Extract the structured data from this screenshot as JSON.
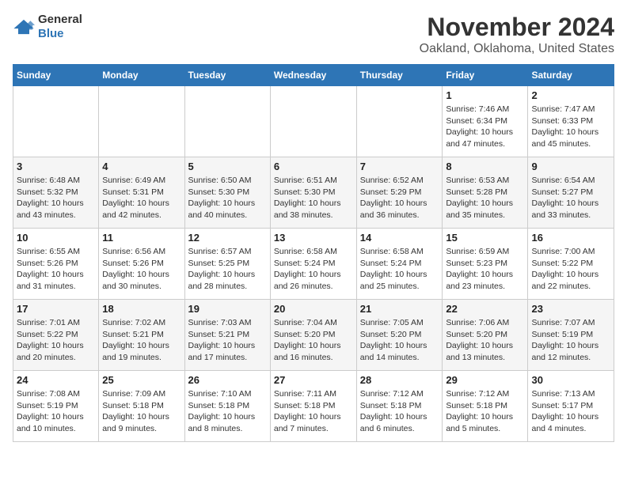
{
  "logo": {
    "general": "General",
    "blue": "Blue"
  },
  "title": "November 2024",
  "location": "Oakland, Oklahoma, United States",
  "days_of_week": [
    "Sunday",
    "Monday",
    "Tuesday",
    "Wednesday",
    "Thursday",
    "Friday",
    "Saturday"
  ],
  "weeks": [
    [
      {
        "day": "",
        "info": ""
      },
      {
        "day": "",
        "info": ""
      },
      {
        "day": "",
        "info": ""
      },
      {
        "day": "",
        "info": ""
      },
      {
        "day": "",
        "info": ""
      },
      {
        "day": "1",
        "info": "Sunrise: 7:46 AM\nSunset: 6:34 PM\nDaylight: 10 hours and 47 minutes."
      },
      {
        "day": "2",
        "info": "Sunrise: 7:47 AM\nSunset: 6:33 PM\nDaylight: 10 hours and 45 minutes."
      }
    ],
    [
      {
        "day": "3",
        "info": "Sunrise: 6:48 AM\nSunset: 5:32 PM\nDaylight: 10 hours and 43 minutes."
      },
      {
        "day": "4",
        "info": "Sunrise: 6:49 AM\nSunset: 5:31 PM\nDaylight: 10 hours and 42 minutes."
      },
      {
        "day": "5",
        "info": "Sunrise: 6:50 AM\nSunset: 5:30 PM\nDaylight: 10 hours and 40 minutes."
      },
      {
        "day": "6",
        "info": "Sunrise: 6:51 AM\nSunset: 5:30 PM\nDaylight: 10 hours and 38 minutes."
      },
      {
        "day": "7",
        "info": "Sunrise: 6:52 AM\nSunset: 5:29 PM\nDaylight: 10 hours and 36 minutes."
      },
      {
        "day": "8",
        "info": "Sunrise: 6:53 AM\nSunset: 5:28 PM\nDaylight: 10 hours and 35 minutes."
      },
      {
        "day": "9",
        "info": "Sunrise: 6:54 AM\nSunset: 5:27 PM\nDaylight: 10 hours and 33 minutes."
      }
    ],
    [
      {
        "day": "10",
        "info": "Sunrise: 6:55 AM\nSunset: 5:26 PM\nDaylight: 10 hours and 31 minutes."
      },
      {
        "day": "11",
        "info": "Sunrise: 6:56 AM\nSunset: 5:26 PM\nDaylight: 10 hours and 30 minutes."
      },
      {
        "day": "12",
        "info": "Sunrise: 6:57 AM\nSunset: 5:25 PM\nDaylight: 10 hours and 28 minutes."
      },
      {
        "day": "13",
        "info": "Sunrise: 6:58 AM\nSunset: 5:24 PM\nDaylight: 10 hours and 26 minutes."
      },
      {
        "day": "14",
        "info": "Sunrise: 6:58 AM\nSunset: 5:24 PM\nDaylight: 10 hours and 25 minutes."
      },
      {
        "day": "15",
        "info": "Sunrise: 6:59 AM\nSunset: 5:23 PM\nDaylight: 10 hours and 23 minutes."
      },
      {
        "day": "16",
        "info": "Sunrise: 7:00 AM\nSunset: 5:22 PM\nDaylight: 10 hours and 22 minutes."
      }
    ],
    [
      {
        "day": "17",
        "info": "Sunrise: 7:01 AM\nSunset: 5:22 PM\nDaylight: 10 hours and 20 minutes."
      },
      {
        "day": "18",
        "info": "Sunrise: 7:02 AM\nSunset: 5:21 PM\nDaylight: 10 hours and 19 minutes."
      },
      {
        "day": "19",
        "info": "Sunrise: 7:03 AM\nSunset: 5:21 PM\nDaylight: 10 hours and 17 minutes."
      },
      {
        "day": "20",
        "info": "Sunrise: 7:04 AM\nSunset: 5:20 PM\nDaylight: 10 hours and 16 minutes."
      },
      {
        "day": "21",
        "info": "Sunrise: 7:05 AM\nSunset: 5:20 PM\nDaylight: 10 hours and 14 minutes."
      },
      {
        "day": "22",
        "info": "Sunrise: 7:06 AM\nSunset: 5:20 PM\nDaylight: 10 hours and 13 minutes."
      },
      {
        "day": "23",
        "info": "Sunrise: 7:07 AM\nSunset: 5:19 PM\nDaylight: 10 hours and 12 minutes."
      }
    ],
    [
      {
        "day": "24",
        "info": "Sunrise: 7:08 AM\nSunset: 5:19 PM\nDaylight: 10 hours and 10 minutes."
      },
      {
        "day": "25",
        "info": "Sunrise: 7:09 AM\nSunset: 5:18 PM\nDaylight: 10 hours and 9 minutes."
      },
      {
        "day": "26",
        "info": "Sunrise: 7:10 AM\nSunset: 5:18 PM\nDaylight: 10 hours and 8 minutes."
      },
      {
        "day": "27",
        "info": "Sunrise: 7:11 AM\nSunset: 5:18 PM\nDaylight: 10 hours and 7 minutes."
      },
      {
        "day": "28",
        "info": "Sunrise: 7:12 AM\nSunset: 5:18 PM\nDaylight: 10 hours and 6 minutes."
      },
      {
        "day": "29",
        "info": "Sunrise: 7:12 AM\nSunset: 5:18 PM\nDaylight: 10 hours and 5 minutes."
      },
      {
        "day": "30",
        "info": "Sunrise: 7:13 AM\nSunset: 5:17 PM\nDaylight: 10 hours and 4 minutes."
      }
    ]
  ]
}
